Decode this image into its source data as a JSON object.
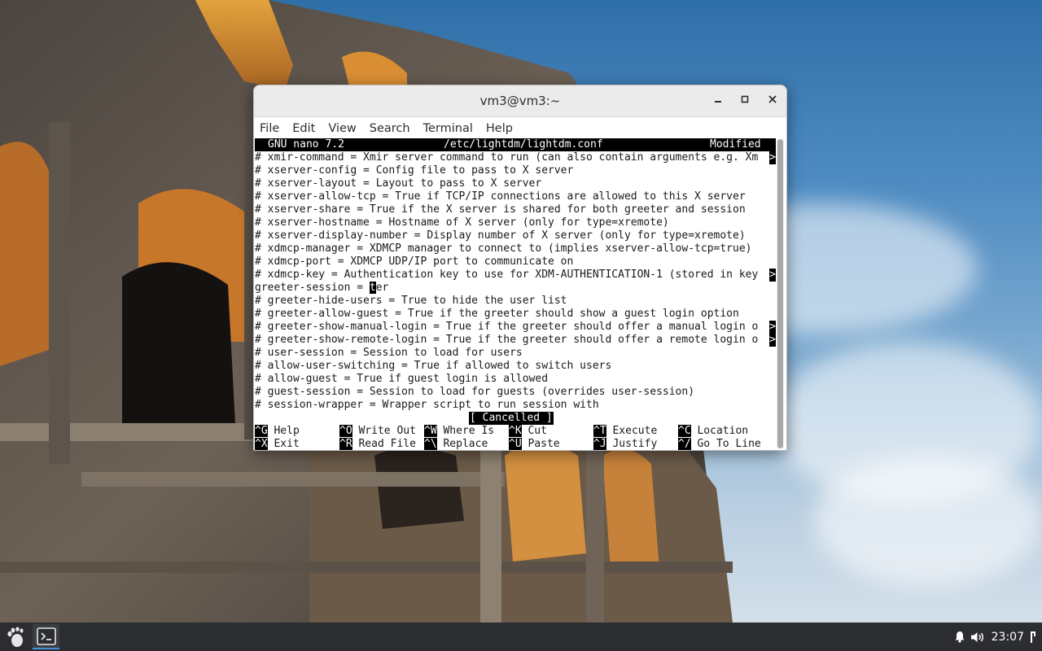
{
  "window": {
    "title": "vm3@vm3:~",
    "controls": {
      "minimize": "–",
      "maximize": "□",
      "close": "✕"
    }
  },
  "menubar": [
    "File",
    "Edit",
    "View",
    "Search",
    "Terminal",
    "Help"
  ],
  "nano": {
    "header": {
      "version": "GNU nano 7.2",
      "file": "/etc/lightdm/lightdm.conf",
      "state": "Modified"
    },
    "lines": [
      {
        "text": "# xmir-command = Xmir server command to run (can also contain arguments e.g. Xm",
        "overflow": ">"
      },
      {
        "text": "# xserver-config = Config file to pass to X server"
      },
      {
        "text": "# xserver-layout = Layout to pass to X server"
      },
      {
        "text": "# xserver-allow-tcp = True if TCP/IP connections are allowed to this X server"
      },
      {
        "text": "# xserver-share = True if the X server is shared for both greeter and session"
      },
      {
        "text": "# xserver-hostname = Hostname of X server (only for type=xremote)"
      },
      {
        "text": "# xserver-display-number = Display number of X server (only for type=xremote)"
      },
      {
        "text": "# xdmcp-manager = XDMCP manager to connect to (implies xserver-allow-tcp=true)"
      },
      {
        "text": "# xdmcp-port = XDMCP UDP/IP port to communicate on"
      },
      {
        "text": "# xdmcp-key = Authentication key to use for XDM-AUTHENTICATION-1 (stored in key",
        "overflow": ">"
      },
      {
        "text": "greeter-session = ",
        "cursor": "t",
        "after": "er"
      },
      {
        "text": "# greeter-hide-users = True to hide the user list"
      },
      {
        "text": "# greeter-allow-guest = True if the greeter should show a guest login option"
      },
      {
        "text": "# greeter-show-manual-login = True if the greeter should offer a manual login o",
        "overflow": ">"
      },
      {
        "text": "# greeter-show-remote-login = True if the greeter should offer a remote login o",
        "overflow": ">"
      },
      {
        "text": "# user-session = Session to load for users"
      },
      {
        "text": "# allow-user-switching = True if allowed to switch users"
      },
      {
        "text": "# allow-guest = True if guest login is allowed"
      },
      {
        "text": "# guest-session = Session to load for guests (overrides user-session)"
      },
      {
        "text": "# session-wrapper = Wrapper script to run session with"
      }
    ],
    "status_message": "[ Cancelled ]",
    "shortcuts": [
      [
        {
          "key": "^G",
          "label": "Help"
        },
        {
          "key": "^O",
          "label": "Write Out"
        },
        {
          "key": "^W",
          "label": "Where Is"
        },
        {
          "key": "^K",
          "label": "Cut"
        },
        {
          "key": "^T",
          "label": "Execute"
        },
        {
          "key": "^C",
          "label": "Location"
        }
      ],
      [
        {
          "key": "^X",
          "label": "Exit"
        },
        {
          "key": "^R",
          "label": "Read File"
        },
        {
          "key": "^\\",
          "label": "Replace"
        },
        {
          "key": "^U",
          "label": "Paste"
        },
        {
          "key": "^J",
          "label": "Justify"
        },
        {
          "key": "^/",
          "label": "Go To Line"
        }
      ]
    ]
  },
  "taskbar": {
    "apps": [
      {
        "icon": "gnome-foot-icon"
      },
      {
        "icon": "terminal-icon",
        "active": true
      }
    ],
    "tray": {
      "icons": [
        "bell-icon",
        "volume-icon",
        "power-icon"
      ],
      "clock": "23:07"
    }
  },
  "colors": {
    "taskbar": "#2b2d31",
    "nano_inverse_bg": "#000000",
    "window_bg": "#ffffff",
    "active_indicator": "#4a90d9"
  }
}
